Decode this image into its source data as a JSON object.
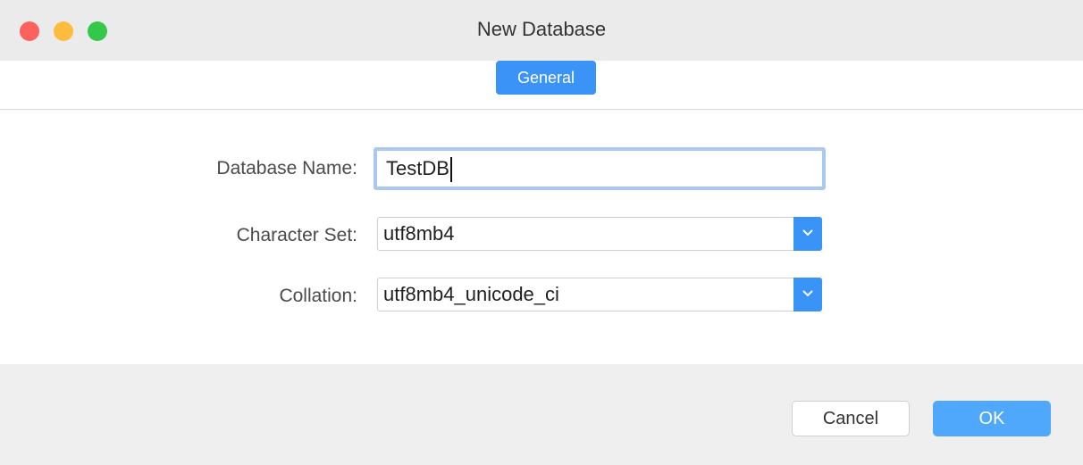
{
  "window": {
    "title": "New Database"
  },
  "tabs": [
    {
      "label": "General",
      "selected": true
    }
  ],
  "form": {
    "database_name": {
      "label": "Database Name:",
      "value": "TestDB"
    },
    "character_set": {
      "label": "Character Set:",
      "value": "utf8mb4"
    },
    "collation": {
      "label": "Collation:",
      "value": "utf8mb4_unicode_ci"
    }
  },
  "buttons": {
    "cancel_label": "Cancel",
    "ok_label": "OK"
  },
  "colors": {
    "accent": "#3a93f6",
    "close": "#fc615d",
    "minimize": "#fdbc40",
    "zoom": "#34c84a"
  },
  "icons": {
    "select_arrow": "chevron-down-icon"
  }
}
